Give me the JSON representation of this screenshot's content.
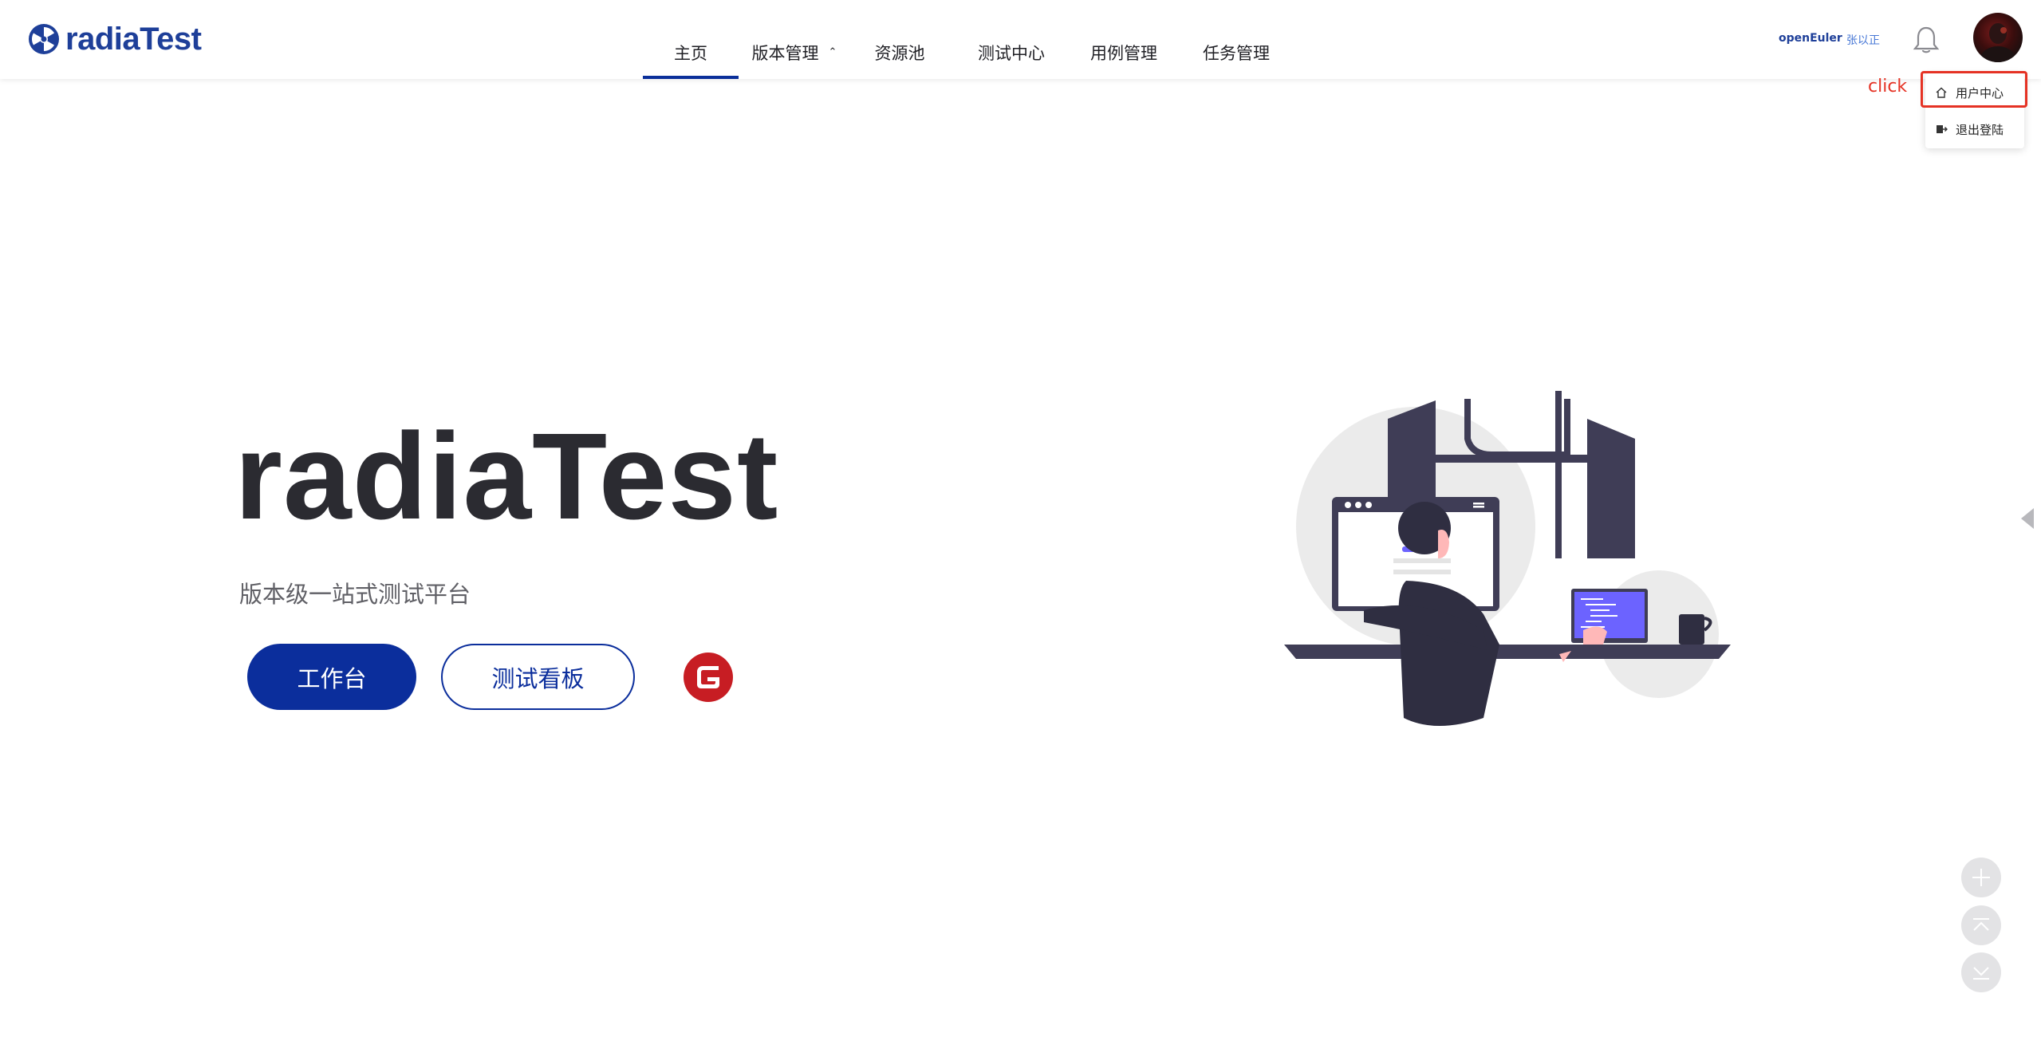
{
  "header": {
    "logo_text": "radiaTest",
    "nav": [
      {
        "label": "主页",
        "active": true
      },
      {
        "label": "版本管理",
        "has_dropdown": true
      },
      {
        "label": "资源池"
      },
      {
        "label": "测试中心"
      },
      {
        "label": "用例管理"
      },
      {
        "label": "任务管理"
      }
    ],
    "org_name": "openEuler",
    "user_name": "张以正"
  },
  "dropdown": {
    "items": [
      {
        "label": "用户中心",
        "icon": "home-icon"
      },
      {
        "label": "退出登陆",
        "icon": "logout-icon"
      }
    ]
  },
  "annotation": {
    "click_label": "click",
    "color": "#e53224"
  },
  "hero": {
    "title": "radiaTest",
    "subtitle": "版本级一站式测试平台",
    "primary_button": "工作台",
    "secondary_button": "测试看板",
    "gitee_icon": "gitee-icon"
  },
  "colors": {
    "brand": "#0b2e9c",
    "logo": "#1e3f99",
    "link": "#4878d6"
  }
}
